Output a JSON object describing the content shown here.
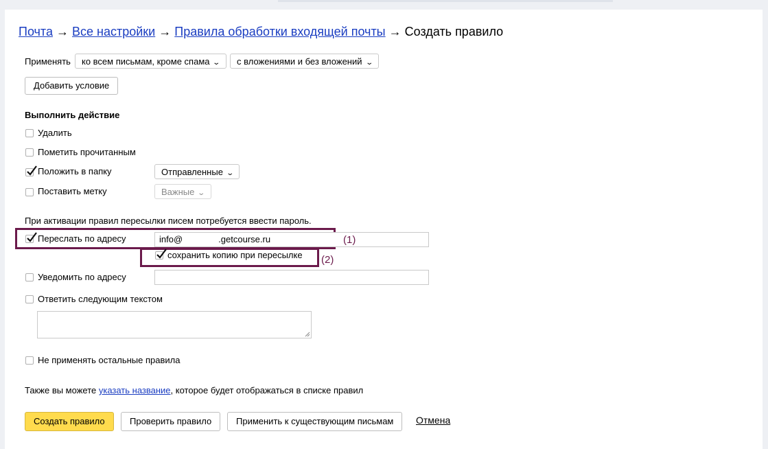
{
  "breadcrumb": {
    "items": [
      "Почта",
      "Все настройки",
      "Правила обработки входящей почты"
    ],
    "separator": "→",
    "current": "Создать правило"
  },
  "apply": {
    "label": "Применять",
    "scope_value": "ко всем письмам, кроме спама",
    "attachments_value": "с вложениями и без вложений",
    "add_condition": "Добавить условие"
  },
  "actions": {
    "heading": "Выполнить действие",
    "delete": {
      "label": "Удалить",
      "checked": false
    },
    "mark_read": {
      "label": "Пометить прочитанным",
      "checked": false
    },
    "move_folder": {
      "label": "Положить в папку",
      "checked": true,
      "folder": "Отправленные"
    },
    "set_label": {
      "label": "Поставить метку",
      "checked": false,
      "tag": "Важные"
    }
  },
  "forward": {
    "password_note": "При активации правил пересылки писем потребуется ввести пароль.",
    "label": "Переслать по адресу",
    "checked": true,
    "address_prefix": "info@",
    "address_suffix": ".getcourse.ru",
    "keep_copy": {
      "label": "сохранить копию при пересылке",
      "checked": true
    },
    "annotation_1": "(1)",
    "annotation_2": "(2)"
  },
  "notify": {
    "label": "Уведомить по адресу",
    "checked": false,
    "value": ""
  },
  "reply": {
    "label": "Ответить следующим текстом",
    "checked": false,
    "text": ""
  },
  "stop_rules": {
    "label": "Не применять остальные правила",
    "checked": false
  },
  "naming": {
    "prefix": "Также вы можете ",
    "link": "указать название",
    "suffix": ", которое будет отображаться в списке правил"
  },
  "footer": {
    "create": "Создать правило",
    "check": "Проверить правило",
    "apply_existing": "Применить к существующим письмам",
    "cancel": "Отмена"
  },
  "colors": {
    "accent_yellow": "#ffdb4d",
    "link_blue": "#1a3dc1",
    "highlight_frame": "#6b1a4b"
  }
}
